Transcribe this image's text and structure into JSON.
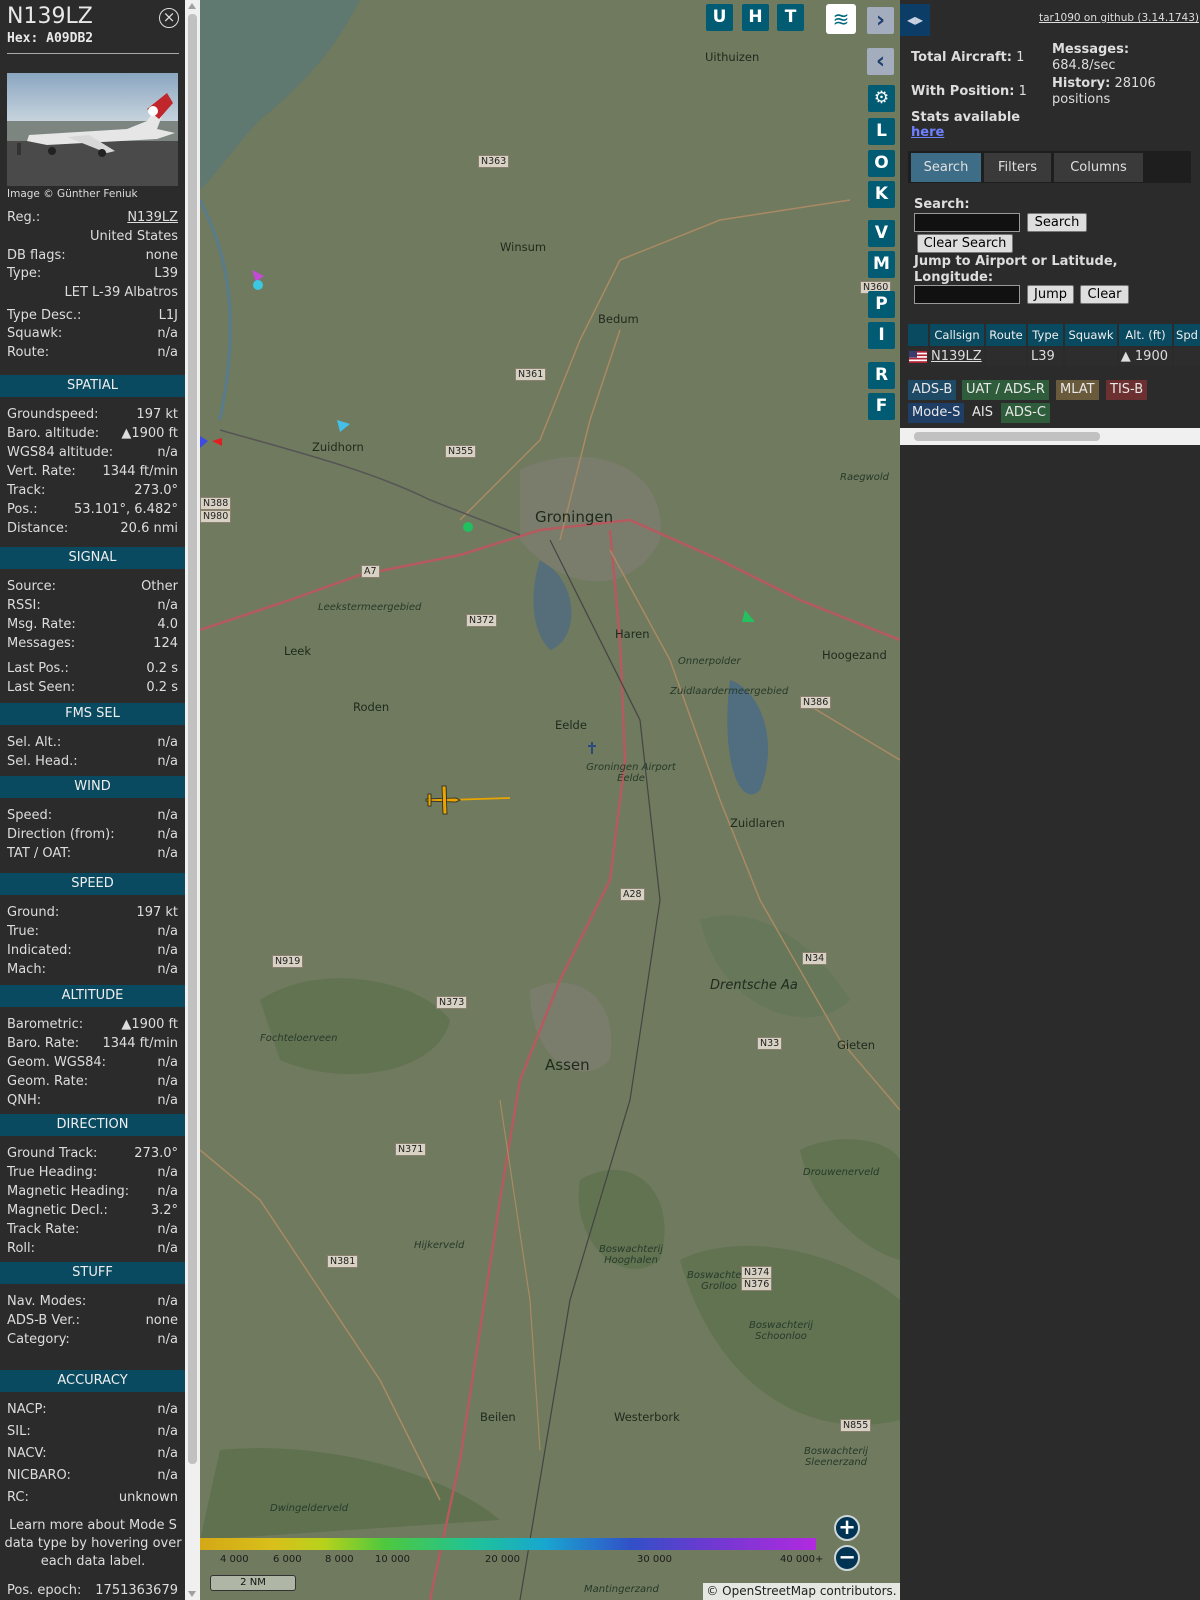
{
  "info": {
    "registration": "N139LZ",
    "hex_label": "Hex:",
    "hex_value": "A09DB2",
    "photo_credit": "Image © Günther Feniuk",
    "basic": [
      {
        "k": "Reg.:",
        "v": "N139LZ"
      },
      {
        "k": "",
        "v": "United States"
      },
      {
        "k": "DB flags:",
        "v": "none"
      },
      {
        "k": "Type:",
        "v": "L39"
      },
      {
        "k": "",
        "v": "LET L-39 Albatros"
      },
      {
        "k": "Type Desc.:",
        "v": "L1J"
      },
      {
        "k": "Squawk:",
        "v": "n/a"
      },
      {
        "k": "Route:",
        "v": "n/a"
      }
    ],
    "sections": [
      {
        "title": "SPATIAL",
        "rows": [
          {
            "k": "Groundspeed:",
            "v": "197 kt"
          },
          {
            "k": "Baro. altitude:",
            "v": "▲1900 ft"
          },
          {
            "k": "WGS84 altitude:",
            "v": "n/a"
          },
          {
            "k": "Vert. Rate:",
            "v": "1344 ft/min"
          },
          {
            "k": "Track:",
            "v": "273.0°"
          },
          {
            "k": "Pos.:",
            "v": "53.101°, 6.482°"
          },
          {
            "k": "Distance:",
            "v": "20.6 nmi"
          }
        ]
      },
      {
        "title": "SIGNAL",
        "rows": [
          {
            "k": "Source:",
            "v": "Other"
          },
          {
            "k": "RSSI:",
            "v": "n/a"
          },
          {
            "k": "Msg. Rate:",
            "v": "4.0"
          },
          {
            "k": "Messages:",
            "v": "124"
          },
          {
            "k": "Last Pos.:",
            "v": "0.2 s"
          },
          {
            "k": "Last Seen:",
            "v": "0.2 s"
          }
        ]
      },
      {
        "title": "FMS SEL",
        "rows": [
          {
            "k": "Sel. Alt.:",
            "v": "n/a"
          },
          {
            "k": "Sel. Head.:",
            "v": "n/a"
          }
        ]
      },
      {
        "title": "WIND",
        "rows": [
          {
            "k": "Speed:",
            "v": "n/a"
          },
          {
            "k": "Direction (from):",
            "v": "n/a"
          },
          {
            "k": "TAT / OAT:",
            "v": "n/a"
          }
        ]
      },
      {
        "title": "SPEED",
        "rows": [
          {
            "k": "Ground:",
            "v": "197 kt"
          },
          {
            "k": "True:",
            "v": "n/a"
          },
          {
            "k": "Indicated:",
            "v": "n/a"
          },
          {
            "k": "Mach:",
            "v": "n/a"
          }
        ]
      },
      {
        "title": "ALTITUDE",
        "rows": [
          {
            "k": "Barometric:",
            "v": "▲1900 ft"
          },
          {
            "k": "Baro. Rate:",
            "v": "1344 ft/min"
          },
          {
            "k": "Geom. WGS84:",
            "v": "n/a"
          },
          {
            "k": "Geom. Rate:",
            "v": "n/a"
          },
          {
            "k": "QNH:",
            "v": "n/a"
          }
        ]
      },
      {
        "title": "DIRECTION",
        "rows": [
          {
            "k": "Ground Track:",
            "v": "273.0°"
          },
          {
            "k": "True Heading:",
            "v": "n/a"
          },
          {
            "k": "Magnetic Heading:",
            "v": "n/a"
          },
          {
            "k": "Magnetic Decl.:",
            "v": "3.2°"
          },
          {
            "k": "Track Rate:",
            "v": "n/a"
          },
          {
            "k": "Roll:",
            "v": "n/a"
          }
        ]
      },
      {
        "title": "STUFF",
        "rows": [
          {
            "k": "Nav. Modes:",
            "v": "n/a"
          },
          {
            "k": "ADS-B Ver.:",
            "v": "none"
          },
          {
            "k": "Category:",
            "v": "n/a"
          }
        ]
      },
      {
        "title": "ACCURACY",
        "rows": [
          {
            "k": "NACP:",
            "v": "n/a"
          },
          {
            "k": "SIL:",
            "v": "n/a"
          },
          {
            "k": "NACV:",
            "v": "n/a"
          },
          {
            "k": "NICBARO:",
            "v": "n/a"
          },
          {
            "k": "RC:",
            "v": "unknown"
          }
        ]
      }
    ],
    "note": "Learn more about Mode S data type by hovering over each data label.",
    "epoch_label": "Pos. epoch:",
    "epoch_value": "1751363679"
  },
  "map": {
    "buttons_top": [
      "U",
      "H",
      "T"
    ],
    "buttons_side": [
      "L",
      "O",
      "K",
      "V",
      "M",
      "P",
      "I",
      "R",
      "F"
    ],
    "places": [
      {
        "name": "Uithuizen"
      },
      {
        "name": "Winsum"
      },
      {
        "name": "Bedum"
      },
      {
        "name": "Zuidhorn"
      },
      {
        "name": "Groningen"
      },
      {
        "name": "Leekstermeergebied"
      },
      {
        "name": "Haren"
      },
      {
        "name": "Leek"
      },
      {
        "name": "Hoogezand"
      },
      {
        "name": "Onnerpolder"
      },
      {
        "name": "Zuidlaardermeergebied"
      },
      {
        "name": "Roden"
      },
      {
        "name": "Eelde"
      },
      {
        "name": "Groningen Airport Eelde"
      },
      {
        "name": "Zuidlaren"
      },
      {
        "name": "Drentsche Aa"
      },
      {
        "name": "Fochteloerveen"
      },
      {
        "name": "Assen"
      },
      {
        "name": "Gieten"
      },
      {
        "name": "Drouwenerveld"
      },
      {
        "name": "Hijkerveld"
      },
      {
        "name": "Boswachterij Hooghalen"
      },
      {
        "name": "Boswachterij Grolloo"
      },
      {
        "name": "Boswachterij Schoonloo"
      },
      {
        "name": "Beilen"
      },
      {
        "name": "Westerbork"
      },
      {
        "name": "Boswachterij Sleenerzand"
      },
      {
        "name": "Dwingelderveld"
      },
      {
        "name": "Mantingerzand"
      },
      {
        "name": "Raegwold"
      }
    ],
    "roads": [
      "N363",
      "N361",
      "N360",
      "N355",
      "N388",
      "N980",
      "A7",
      "N372",
      "N386",
      "N919",
      "N373",
      "N33",
      "N34",
      "A28",
      "N371",
      "N381",
      "N374",
      "N376",
      "N855"
    ],
    "alt_ticks": [
      "4 000",
      "6 000",
      "8 000",
      "10 000",
      "20 000",
      "30 000",
      "40 000+"
    ],
    "scale": "2 NM",
    "attribution": "© OpenStreetMap contributors."
  },
  "right": {
    "github_link": "tar1090 on github (3.14.1743)",
    "total_label": "Total Aircraft:",
    "total_value": "1",
    "position_label": "With Position:",
    "position_value": "1",
    "messages_label": "Messages:",
    "messages_value": "684.8/sec",
    "history_label": "History:",
    "history_value": "28106 positions",
    "stats_label": "Stats available",
    "stats_link": "here",
    "tabs": [
      "Search",
      "Filters",
      "Columns"
    ],
    "search_label": "Search:",
    "search_button": "Search",
    "clear_search_button": "Clear Search",
    "jump_label": "Jump to Airport or Latitude, Longitude:",
    "jump_button": "Jump",
    "clear_button": "Clear",
    "table_headers": [
      "Callsign",
      "Route",
      "Type",
      "Squawk",
      "Alt. (ft)",
      "Spd"
    ],
    "table_row": {
      "callsign": "N139LZ",
      "route": "",
      "type": "L39",
      "squawk": "",
      "alt": "▲ 1900"
    },
    "sources": [
      {
        "label": "ADS-B",
        "color": "#1f4a66"
      },
      {
        "label": "UAT / ADS-R",
        "color": "#2f5d3b"
      },
      {
        "label": "MLAT",
        "color": "#6a5a3c"
      },
      {
        "label": "TIS-B",
        "color": "#6d3030"
      },
      {
        "label": "Mode-S",
        "color": "#1e3e66"
      },
      {
        "label": "AIS",
        "color": "#2b2b2b"
      },
      {
        "label": "ADS-C",
        "color": "#2f5d3b"
      }
    ]
  }
}
